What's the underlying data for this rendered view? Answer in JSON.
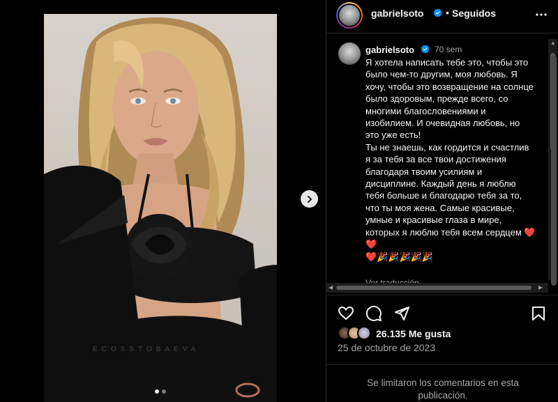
{
  "post": {
    "username": "gabrielsoto",
    "follow_status": "Seguidos",
    "dot": "•"
  },
  "caption": {
    "username": "gabrielsoto",
    "time": "70 sem",
    "text": "Я хотела написать тебе это, чтобы это было чем-то другим, моя любовь. Я хочу, чтобы это возвращение на солнце было здоровым, прежде всего, со многими благословениями и изобилием. И очевидная любовь, но это уже есть!\nТы не знаешь, как гордится и счастлив я за тебя за все твои достижения благодаря твоим усилиям и дисциплине. Каждый день я люблю тебя больше и благодарю тебя за то, что ты моя жена. Самые красивые, умные и красивые глаза в мире, которых я люблю тебя всем сердцем ❤️❤️\n❤️🎉🎉🎉🎉🎉",
    "translate": "Ver traducción"
  },
  "media": {
    "watermark": "ECOSSTOBAEVA",
    "carousel_count": 2,
    "carousel_active": 0
  },
  "likes": {
    "text": "26.135 Me gusta"
  },
  "date": "25 de octubre de 2023",
  "comments_notice": "Se limitaron los comentarios en esta publicación.",
  "icons": {
    "like": "heart-icon",
    "comment": "comment-icon",
    "share": "share-icon",
    "save": "bookmark-icon",
    "more": "more-icon",
    "next": "chevron-right-icon",
    "verified": "verified-badge-icon"
  },
  "colors": {
    "background": "#000000",
    "verified": "#0095f6",
    "text_secondary": "#a8a8a8"
  }
}
